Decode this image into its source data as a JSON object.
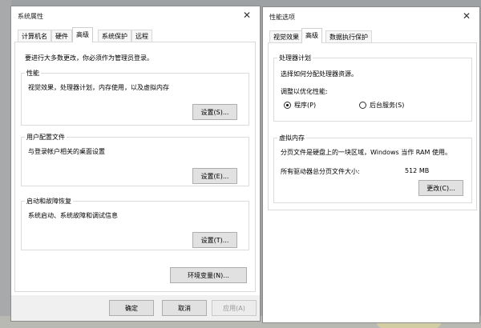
{
  "system_properties": {
    "title": "系统属性",
    "tabs": [
      "计算机名",
      "硬件",
      "高级",
      "系统保护",
      "远程"
    ],
    "admin_note": "要进行大多数更改，你必须作为管理员登录。",
    "performance": {
      "title": "性能",
      "desc": "视觉效果，处理器计划，内存使用，以及虚拟内存",
      "button": "设置(S)..."
    },
    "user_profiles": {
      "title": "用户配置文件",
      "desc": "与登录帐户相关的桌面设置",
      "button": "设置(E)..."
    },
    "startup_recovery": {
      "title": "启动和故障恢复",
      "desc": "系统启动、系统故障和调试信息",
      "button": "设置(T)..."
    },
    "env_button": "环境变量(N)...",
    "footer": {
      "ok": "确定",
      "cancel": "取消",
      "apply": "应用(A)"
    }
  },
  "performance_options": {
    "title": "性能选项",
    "tabs": [
      "视觉效果",
      "高级",
      "数据执行保护"
    ],
    "processor": {
      "title": "处理器计划",
      "desc": "选择如何分配处理器资源。",
      "adjust_label": "调整以优化性能:",
      "options": [
        "程序(P)",
        "后台服务(S)"
      ],
      "selected": "程序(P)"
    },
    "virtual_memory": {
      "title": "虚拟内存",
      "desc": "分页文件是硬盘上的一块区域，Windows 当作 RAM 使用。",
      "total_label": "所有驱动器总分页文件大小:",
      "total_value": "512 MB",
      "change_button": "更改(C)..."
    }
  }
}
